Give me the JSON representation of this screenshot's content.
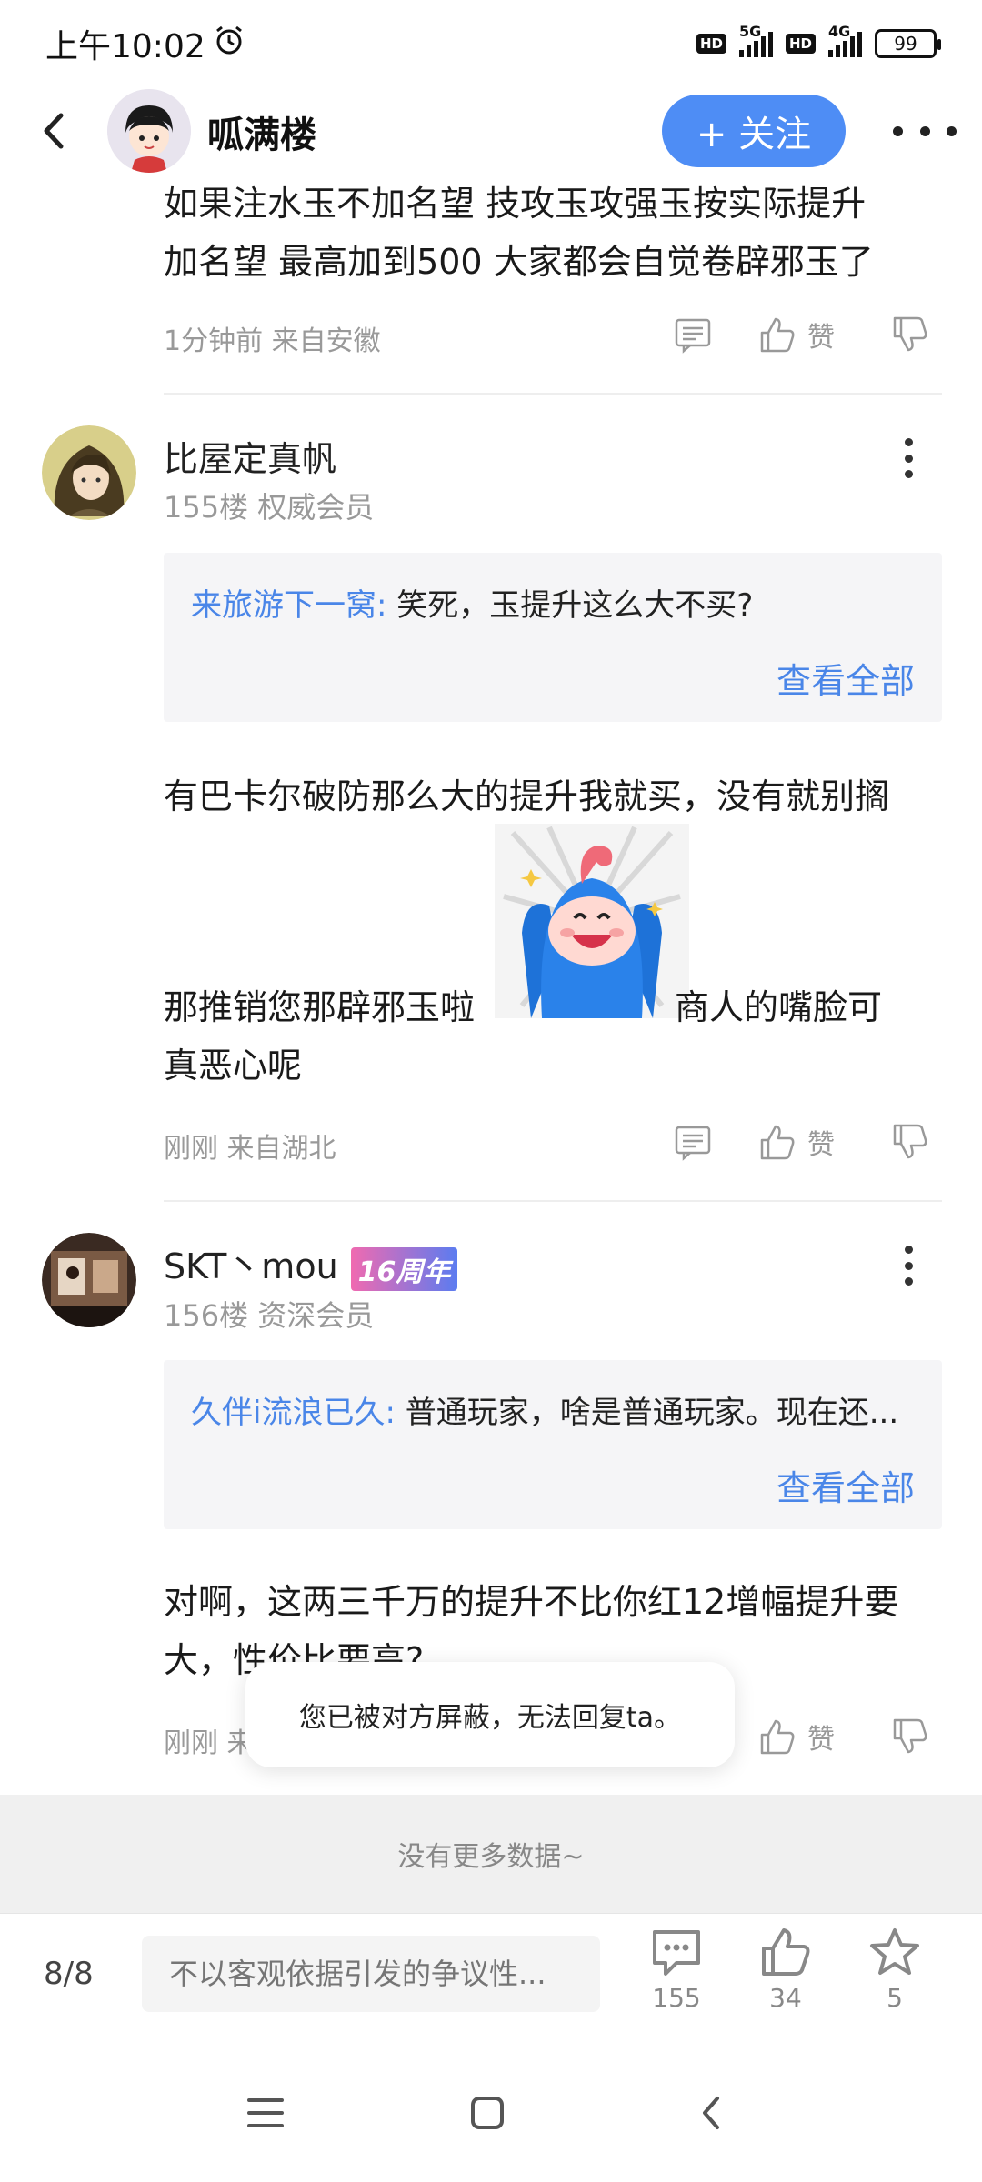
{
  "status_bar": {
    "time": "上午10:02",
    "net1": "5G",
    "net2": "4G",
    "battery": "99"
  },
  "header": {
    "title": "呱满楼",
    "follow_label": "+ 关注"
  },
  "post_top": {
    "text_line1": "如果注水玉不加名望 技攻玉攻强玉按实际提升",
    "text_line2": "加名望 最高加到500 大家都会自觉卷辟邪玉了",
    "meta": "1分钟前 来自安徽",
    "like_label": "赞"
  },
  "comment1": {
    "name": "比屋定真帆",
    "sub": "155楼 权威会员",
    "quote_name": "来旅游下一窝:",
    "quote_text": "笑死，玉提升这么大不买?",
    "view_all": "查看全部",
    "text_line1": "有巴卡尔破防那么大的提升我就买，没有就别搁",
    "text_line2": "那推销您那辟邪玉啦",
    "text_line2b": "商人的嘴脸可",
    "text_line3": "真恶心呢",
    "meta": "刚刚 来自湖北",
    "like_label": "赞"
  },
  "comment2": {
    "name": "SKT丶mou",
    "badge": "16周年",
    "sub": "156楼 资深会员",
    "quote_name": "久伴i流浪已久:",
    "quote_text": "普通玩家，啥是普通玩家。现在还...",
    "view_all": "查看全部",
    "text_line1": "对啊，这两三千万的提升不比你红12增幅提升要",
    "text_line2": "大，性价比要高?",
    "meta": "刚刚 来自",
    "like_label": "赞"
  },
  "toast": "您已被对方屏蔽，无法回复ta。",
  "no_more": "没有更多数据~",
  "bottom_bar": {
    "page_count": "8/8",
    "input_placeholder": "不以客观依据引发的争议性...",
    "comments_count": "155",
    "likes_count": "34",
    "favorites_count": "5"
  },
  "colors": {
    "accent": "#4e8df5",
    "link": "#4a86e8",
    "meta_gray": "#999999"
  }
}
